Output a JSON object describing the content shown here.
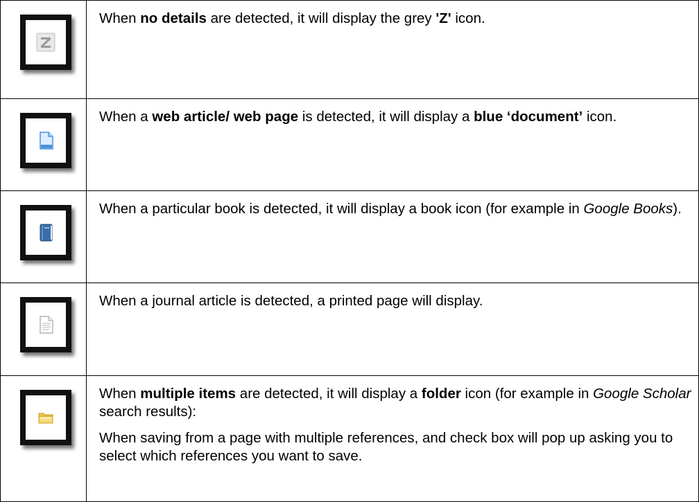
{
  "rows": [
    {
      "icon": "grey-z-icon",
      "text": [
        {
          "t": "When ",
          "style": "normal"
        },
        {
          "t": "no details",
          "style": "bold"
        },
        {
          "t": " are detected, it will display the grey ",
          "style": "normal"
        },
        {
          "t": "'Z'",
          "style": "bold"
        },
        {
          "t": " icon.",
          "style": "normal"
        }
      ]
    },
    {
      "icon": "blue-document-icon",
      "text": [
        {
          "t": "When a ",
          "style": "normal"
        },
        {
          "t": "web article/ web page",
          "style": "bold"
        },
        {
          "t": " is detected, it will display a ",
          "style": "normal"
        },
        {
          "t": "blue ‘document’",
          "style": "bold"
        },
        {
          "t": " icon.",
          "style": "normal"
        }
      ]
    },
    {
      "icon": "book-icon",
      "text": [
        {
          "t": "When a particular book is detected, it will display a book icon (for example in ",
          "style": "normal"
        },
        {
          "t": "Google Books",
          "style": "italic"
        },
        {
          "t": ").",
          "style": "normal"
        }
      ]
    },
    {
      "icon": "printed-page-icon",
      "text": [
        {
          "t": "When a journal article is detected, a printed page will display.",
          "style": "normal"
        }
      ]
    },
    {
      "icon": "folder-icon",
      "text": [
        {
          "t": "When ",
          "style": "normal"
        },
        {
          "t": "multiple items",
          "style": "bold"
        },
        {
          "t": " are detected, it will display a ",
          "style": "normal"
        },
        {
          "t": "folder",
          "style": "bold"
        },
        {
          "t": " icon (for example in ",
          "style": "normal"
        },
        {
          "t": "Google Scholar",
          "style": "italic"
        },
        {
          "t": " search results):",
          "style": "normal"
        }
      ],
      "text2": "When saving from a page with multiple references, and check box will pop up asking you to select which references you want to save."
    }
  ],
  "colors": {
    "grey_z": "#9a9a9a",
    "doc_blue": "#4a90d9",
    "book_blue": "#3b6ea8",
    "folder_yellow": "#f2c94c"
  }
}
